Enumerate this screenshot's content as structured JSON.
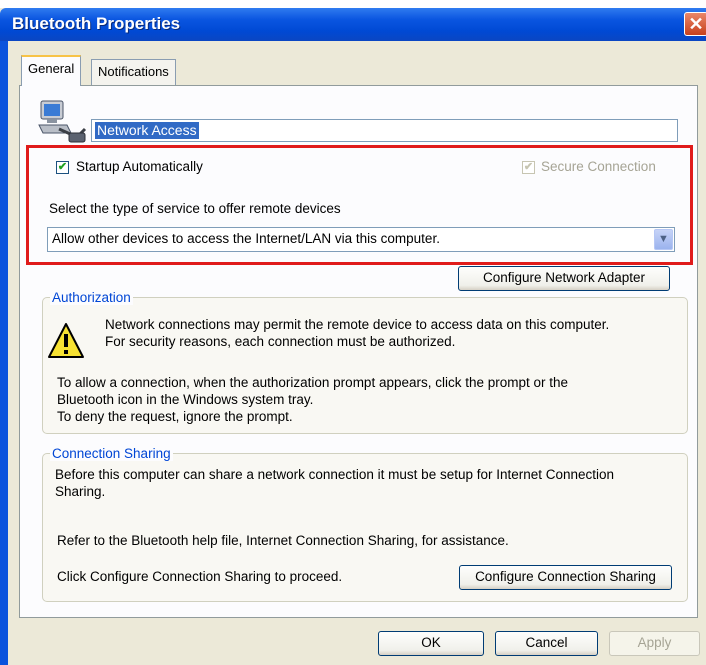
{
  "window": {
    "title": "Bluetooth Properties",
    "close_glyph": "✕"
  },
  "tabs": [
    {
      "label": "General",
      "active": true
    },
    {
      "label": "Notifications",
      "active": false
    }
  ],
  "general": {
    "service_icon": "bluetooth-network-icon",
    "service_name": "Network Access",
    "startup_label": "Startup Automatically",
    "startup_checked": true,
    "secure_label": "Secure Connection",
    "secure_checked": true,
    "secure_enabled": false,
    "select_prompt": "Select the type of service to offer remote devices",
    "service_type_value": "Allow other devices to access the Internet/LAN via this computer.",
    "configure_adapter_label": "Configure Network Adapter"
  },
  "authorization": {
    "legend": "Authorization",
    "warning_icon": "warning-icon",
    "line1": "Network connections may permit the remote device to access data on this computer.",
    "line2": "For security reasons, each connection must be authorized.",
    "line3": "To allow a connection, when the authorization prompt appears, click the prompt or the",
    "line4": "Bluetooth icon in the Windows system tray.",
    "line5": "To deny the request, ignore the prompt."
  },
  "sharing": {
    "legend": "Connection Sharing",
    "line1": "Before this computer can share a network connection it must be setup for Internet Connection",
    "line2": "Sharing.",
    "line3": "Refer to the Bluetooth help file, Internet Connection Sharing, for assistance.",
    "line4": "Click Configure Connection Sharing to proceed.",
    "configure_sharing_label": "Configure Connection Sharing"
  },
  "footer": {
    "ok_label": "OK",
    "cancel_label": "Cancel",
    "apply_label": "Apply"
  },
  "colors": {
    "title_bar": "#0a55e0",
    "highlight_box": "#e01b1b",
    "group_legend": "#0046d5"
  }
}
